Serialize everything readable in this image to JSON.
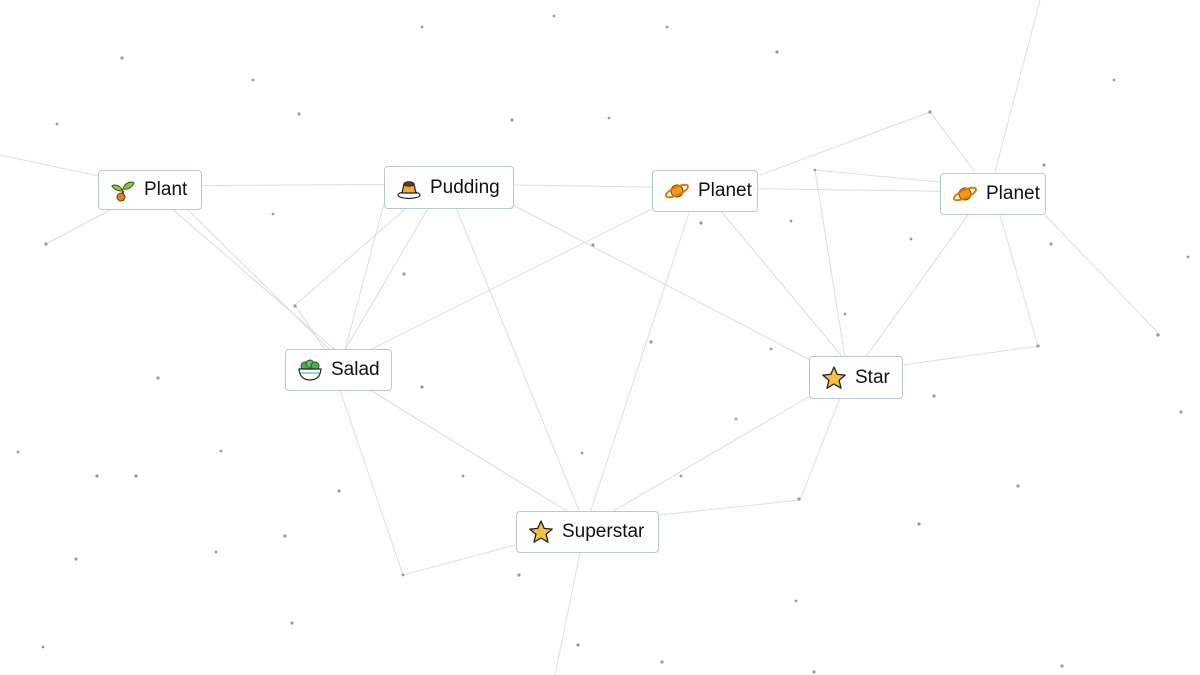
{
  "canvas": {
    "items": [
      {
        "label": "Plant",
        "icon": "sprout-icon"
      },
      {
        "label": "Pudding",
        "icon": "pudding-icon"
      },
      {
        "label": "Planet",
        "icon": "planet-icon"
      },
      {
        "label": "Planet",
        "icon": "planet-icon"
      },
      {
        "label": "Salad",
        "icon": "salad-icon"
      },
      {
        "label": "Star",
        "icon": "star-icon"
      },
      {
        "label": "Superstar",
        "icon": "star-icon"
      }
    ]
  },
  "colors": {
    "background": "#ffffff",
    "item_border": "#b9c6d3",
    "link_line": "#d9dde2",
    "dot": "#9a9a9a",
    "star_fill": "#f5c142",
    "planet_fill": "#f39a1e"
  }
}
